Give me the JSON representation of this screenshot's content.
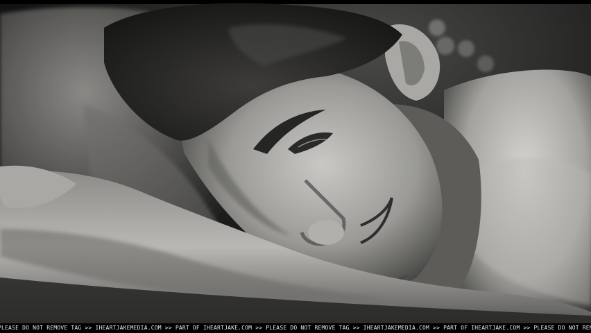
{
  "image": {
    "description_icon": "photo-monochrome-portrait",
    "palette": {
      "background": "#000000",
      "highlight": "#d9d9d6",
      "midtone": "#6e6d6a",
      "shadow": "#1b1b1a"
    }
  },
  "watermark": {
    "text": "PLEASE DO NOT REMOVE TAG >> IHEARTJAKEMEDIA.COM >> PART OF IHEARTJAKE.COM >> PLEASE DO NOT REMOVE TAG >> IHEARTJAKEMEDIA.COM >> PART OF IHEARTJAKE.COM >> PLEASE DO NOT REMOVE TAG >> IHEARTJAKEN"
  }
}
